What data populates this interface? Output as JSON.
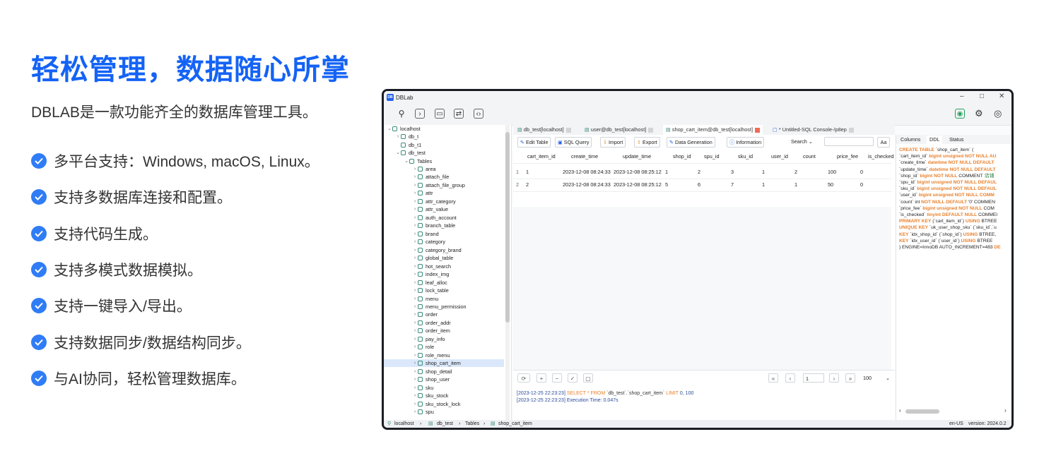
{
  "hero": {
    "title": "轻松管理，数据随心所掌",
    "subtitle": "DBLAB是一款功能齐全的数据库管理工具。",
    "features": [
      "多平台支持：Windows, macOS, Linux。",
      "支持多数据库连接和配置。",
      "支持代码生成。",
      "支持多模式数据模拟。",
      "支持一键导入/导出。",
      "支持数据同步/数据结构同步。",
      "与AI协同，轻松管理数据库。"
    ]
  },
  "app": {
    "title": "DBLab",
    "logo": "DB",
    "window_controls": [
      "–",
      "□",
      "✕"
    ],
    "tree": {
      "root": "localhost",
      "databases": [
        "db_t",
        "db_t1",
        "db_test"
      ],
      "tables_label": "Tables",
      "tables": [
        "area",
        "attach_file",
        "attach_file_group",
        "attr",
        "attr_category",
        "attr_value",
        "auth_account",
        "branch_table",
        "brand",
        "category",
        "category_brand",
        "global_table",
        "hot_search",
        "index_img",
        "leaf_alloc",
        "lock_table",
        "menu",
        "menu_permission",
        "order",
        "order_addr",
        "order_item",
        "pay_info",
        "role",
        "role_menu",
        "shop_cart_item",
        "shop_detail",
        "shop_user",
        "sku",
        "sku_stock",
        "sku_stock_lock",
        "spu"
      ],
      "selected": "shop_cart_item"
    },
    "tabs": [
      "db_test[localhost]",
      "user@db_test[localhost]",
      "shop_cart_item@db_test[localhost]",
      "* Untitled-SQL Console-/p8ep"
    ],
    "active_tab": 2,
    "buttons": {
      "edit_table": "Edit Table",
      "sql_query": "SQL Query",
      "import": "Import",
      "export": "Export",
      "data_generation": "Data Generation",
      "information": "Information",
      "search": "Search",
      "aa": "Aa"
    },
    "grid": {
      "columns": [
        "cart_item_id",
        "create_time",
        "update_time",
        "shop_id",
        "spu_id",
        "sku_id",
        "user_id",
        "count",
        "price_fee",
        "is_checked"
      ],
      "rows": [
        {
          "n": "1",
          "cells": [
            "1",
            "2023-12-08 08:24:33",
            "2023-12-08 08:25:12",
            "1",
            "2",
            "3",
            "1",
            "2",
            "100",
            "0"
          ]
        },
        {
          "n": "2",
          "cells": [
            "2",
            "2023-12-08 08:24:33",
            "2023-12-08 08:25:12",
            "5",
            "6",
            "7",
            "1",
            "1",
            "50",
            "0"
          ]
        }
      ]
    },
    "pager": {
      "page": "1",
      "page_size": "100"
    },
    "log": {
      "line1_time": "[2023-12-25 22:23:23]",
      "line1_kw1": "SELECT * FROM",
      "line1_table": "`db_test`.`shop_cart_item`",
      "line1_kw2": "LIMIT",
      "line1_args": "0, 100",
      "line2_time": "[2023-12-25 22:23:23]",
      "line2_text": "Execution Time: 0.047s"
    },
    "right_tabs": [
      "Columns",
      "DDL",
      "Status"
    ],
    "right_active": 1,
    "ddl": [
      [
        [
          "k",
          "CREATE TABLE"
        ],
        [
          "t",
          " `shop_cart_item` ("
        ]
      ],
      [
        [
          "t",
          "  `cart_item_id` "
        ],
        [
          "k",
          "bigint unsigned NOT NULL AU"
        ]
      ],
      [
        [
          "t",
          "  `create_time` "
        ],
        [
          "k",
          "datetime NOT NULL DEFAULT"
        ]
      ],
      [
        [
          "t",
          "  `update_time` "
        ],
        [
          "k",
          "datetime NOT NULL DEFAULT"
        ]
      ],
      [
        [
          "t",
          "  `shop_id` "
        ],
        [
          "k",
          "bigint NOT NULL"
        ],
        [
          "t",
          " COMMENT "
        ],
        [
          "c",
          "'店铺"
        ]
      ],
      [
        [
          "t",
          "  `spu_id` "
        ],
        [
          "k",
          "bigint unsigned NOT NULL DEFAUL"
        ]
      ],
      [
        [
          "t",
          "  `sku_id` "
        ],
        [
          "k",
          "bigint unsigned NOT NULL DEFAUL"
        ]
      ],
      [
        [
          "t",
          "  `user_id` "
        ],
        [
          "k",
          "bigint unsigned NOT NULL COMM"
        ]
      ],
      [
        [
          "t",
          "  `count` int "
        ],
        [
          "k",
          "NOT NULL DEFAULT"
        ],
        [
          "t",
          " '0' COMMEN"
        ]
      ],
      [
        [
          "t",
          "  `price_fee` "
        ],
        [
          "k",
          "bigint unsigned NOT NULL"
        ],
        [
          "t",
          " COM"
        ]
      ],
      [
        [
          "t",
          "  `is_checked` "
        ],
        [
          "k",
          "tinyint DEFAULT NULL"
        ],
        [
          "t",
          " COMMEI"
        ]
      ],
      [
        [
          "k",
          "  PRIMARY KEY"
        ],
        [
          "t",
          " (`cart_item_id`) "
        ],
        [
          "k",
          "USING"
        ],
        [
          "t",
          " BTREE"
        ]
      ],
      [
        [
          "k",
          "  UNIQUE KEY"
        ],
        [
          "t",
          " `uk_user_shop_sku` (`sku_id`,`u"
        ]
      ],
      [
        [
          "k",
          "  KEY"
        ],
        [
          "t",
          " `idx_shop_id` (`shop_id`) "
        ],
        [
          "k",
          "USING"
        ],
        [
          "t",
          " BTREE,"
        ]
      ],
      [
        [
          "k",
          "  KEY"
        ],
        [
          "t",
          " `idx_user_id` (`user_id`) "
        ],
        [
          "k",
          "USING"
        ],
        [
          "t",
          " BTREE"
        ]
      ],
      [
        [
          "t",
          ") ENGINE=InnoDB AUTO_INCREMENT=483 "
        ],
        [
          "k",
          "DE"
        ]
      ]
    ],
    "status": {
      "crumbs": [
        "localhost",
        "db_test",
        "Tables",
        "shop_cart_item"
      ],
      "locale": "en-US",
      "version": "version: 2024.0.2"
    }
  }
}
